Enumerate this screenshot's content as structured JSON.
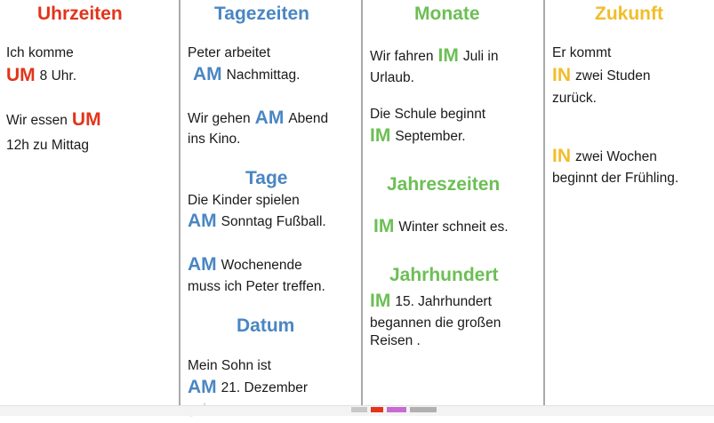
{
  "colors": {
    "uhrzeiten": "#e2341a",
    "tagezeiten": "#4a86c3",
    "monate": "#6cbf55",
    "zukunft": "#f1bd2a",
    "divider": "#a9a9a9"
  },
  "columns": [
    {
      "header": "Uhrzeiten",
      "ex1": {
        "l1": "Ich komme",
        "kw": "UM",
        "l2": "8 Uhr."
      },
      "ex2": {
        "pre": "Wir essen",
        "kw": "UM",
        "l2": "12h zu Mittag"
      }
    },
    {
      "header": "Tagezeiten",
      "ex1": {
        "l1": "Peter arbeitet",
        "kw": "AM",
        "l2": "Nachmittag."
      },
      "ex2": {
        "pre": "Wir gehen",
        "kw": "AM",
        "post": "Abend",
        "l2": "ins Kino."
      },
      "sub1": "Tage",
      "ex3": {
        "l1": "Die Kinder spielen",
        "kw": "AM",
        "l2": "Sonntag Fußball."
      },
      "ex4": {
        "kw": "AM",
        "post": "Wochenende",
        "l2": "muss ich Peter treffen."
      },
      "sub2": "Datum",
      "ex5": {
        "l1": "Mein Sohn ist",
        "kw": "AM",
        "l2": "21. Dezember",
        "l3": "geboren"
      }
    },
    {
      "header": "Monate",
      "ex1": {
        "pre": "Wir fahren",
        "kw": "IM",
        "post": "Juli in",
        "l2": "Urlaub."
      },
      "ex2": {
        "l1": "Die Schule beginnt",
        "kw": "IM",
        "l2": "September."
      },
      "sub1": "Jahreszeiten",
      "ex3": {
        "kw": "IM",
        "l1": "Winter schneit es."
      },
      "sub2": "Jahrhundert",
      "ex4": {
        "kw": "IM",
        "l1": "15. Jahrhundert",
        "l2": "begannen die  großen",
        "l3": "Reisen ."
      }
    },
    {
      "header": "Zukunft",
      "ex1": {
        "l1": "Er kommt",
        "kw": "IN",
        "l2": "zwei Studen",
        "l3": "zurück."
      },
      "ex2": {
        "kw": "IN",
        "l1": "zwei Wochen",
        "l2": "beginnt der Frühling."
      }
    }
  ]
}
